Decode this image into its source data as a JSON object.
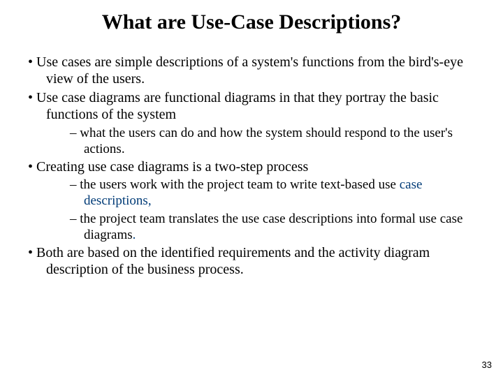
{
  "title": "What are Use-Case Descriptions?",
  "bullets": {
    "b1": "Use cases are simple descriptions of a system's functions from the bird's-eye view of the users.",
    "b2": "Use case diagrams are functional diagrams in that they portray the basic functions of the system",
    "b2_sub1": "what the users can do and how the system should respond to the user's actions.",
    "b3": "Creating use case diagrams is a two-step process",
    "b3_sub1a": "the users work with the project team to write text-based use ",
    "b3_sub1b": "case descriptions",
    "b3_sub1c": ",",
    "b3_sub2a": "the project team translates the use case descriptions into formal use case diagrams",
    "b3_sub2b": ".",
    "b4": "Both are based on the identified requirements and the activity diagram description of the business process."
  },
  "pageNumber": "33"
}
